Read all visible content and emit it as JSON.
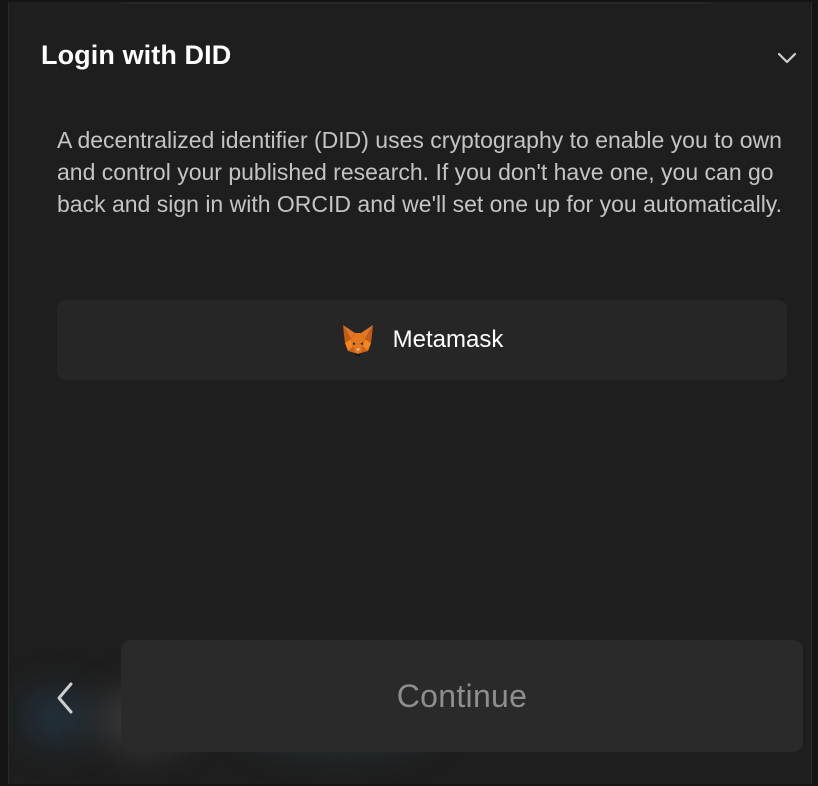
{
  "dialog": {
    "title": "Login with DID",
    "description": "A decentralized identifier (DID) uses cryptography to enable you to own and control your published research. If you don't have one, you can go back and sign in with ORCID and we'll set one up for you automatically.",
    "expand_icon": "chevron-down-icon"
  },
  "wallets": [
    {
      "label": "Metamask",
      "icon": "metamask-fox-icon"
    }
  ],
  "footer": {
    "back_icon": "chevron-left-icon",
    "continue_label": "Continue",
    "continue_enabled": false
  },
  "colors": {
    "background": "#141414",
    "panel": "#1e1e1e",
    "button": "#262626",
    "continue_button": "#2a2a2a",
    "text_primary": "#ffffff",
    "text_secondary": "#c4c4c4",
    "text_disabled": "#8e8e8e",
    "fox_orange": "#e2761b"
  }
}
